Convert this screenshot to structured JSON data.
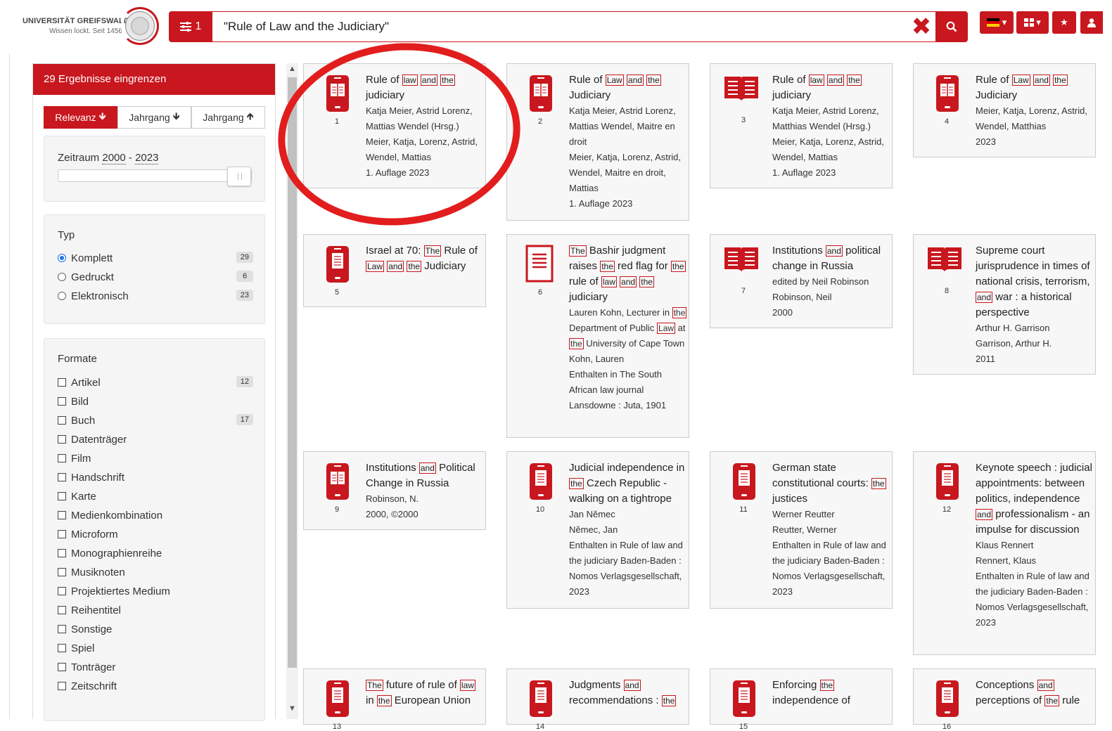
{
  "header": {
    "logo_line1": "UNIVERSITÄT GREIFSWALD",
    "logo_line2": "Wissen lockt. Seit 1456",
    "filter_count": "1",
    "search_value": "\"Rule of Law and the Judiciary\""
  },
  "sidebar": {
    "heading": "29 Ergebnisse eingrenzen",
    "sort": [
      "Relevanz",
      "Jahrgang",
      "Jahrgang"
    ],
    "time_label": "Zeitraum",
    "time_from": "2000",
    "time_sep": " - ",
    "time_to": "2023",
    "type_title": "Typ",
    "types": [
      {
        "label": "Komplett",
        "count": "29"
      },
      {
        "label": "Gedruckt",
        "count": "6"
      },
      {
        "label": "Elektronisch",
        "count": "23"
      }
    ],
    "format_title": "Formate",
    "formats": [
      {
        "label": "Artikel",
        "count": "12"
      },
      {
        "label": "Bild",
        "count": ""
      },
      {
        "label": "Buch",
        "count": "17"
      },
      {
        "label": "Datenträger",
        "count": ""
      },
      {
        "label": "Film",
        "count": ""
      },
      {
        "label": "Handschrift",
        "count": ""
      },
      {
        "label": "Karte",
        "count": ""
      },
      {
        "label": "Medienkombination",
        "count": ""
      },
      {
        "label": "Microform",
        "count": ""
      },
      {
        "label": "Monographienreihe",
        "count": ""
      },
      {
        "label": "Musiknoten",
        "count": ""
      },
      {
        "label": "Projektiertes Medium",
        "count": ""
      },
      {
        "label": "Reihentitel",
        "count": ""
      },
      {
        "label": "Sonstige",
        "count": ""
      },
      {
        "label": "Spiel",
        "count": ""
      },
      {
        "label": "Tonträger",
        "count": ""
      },
      {
        "label": "Zeitschrift",
        "count": ""
      }
    ]
  },
  "results": [
    {
      "num": "1",
      "title": "Rule of |law| |and| |the| judiciary",
      "meta": [
        "Katja Meier, Astrid Lorenz, Mattias Wendel (Hrsg.)",
        "Meier, Katja, Lorenz, Astrid, Wendel, Mattias",
        "1. Auflage 2023"
      ],
      "icon": "ebook-icon"
    },
    {
      "num": "2",
      "title": "Rule of |Law| |and| |the| Judiciary",
      "meta": [
        "Katja Meier, Astrid Lorenz, Mattias Wendel, Maitre en droit",
        "Meier, Katja, Lorenz, Astrid, Wendel, Maitre en droit, Mattias",
        "1. Auflage 2023"
      ],
      "icon": "ebook-icon"
    },
    {
      "num": "3",
      "title": "Rule of |law| |and| |the| judiciary",
      "meta": [
        "Katja Meier, Astrid Lorenz, Matthias Wendel (Hrsg.)",
        "Meier, Katja, Lorenz, Astrid, Wendel, Mattias",
        "1. Auflage 2023"
      ],
      "icon": "book-icon"
    },
    {
      "num": "4",
      "title": "Rule of |Law| |and| |the| Judiciary",
      "meta": [
        "Meier, Katja, Lorenz, Astrid, Wendel, Matthias",
        "2023"
      ],
      "icon": "ebook-icon"
    },
    {
      "num": "5",
      "title": "Israel at 70: |The| Rule of |Law| |and| |the| Judiciary",
      "meta": [],
      "icon": "earticle-icon"
    },
    {
      "num": "6",
      "title": "|The| Bashir judgment raises |the| red flag for |the| rule of |law| |and| |the| judiciary",
      "meta": [
        "Lauren Kohn, Lecturer in |the| Department of Public |Law| at |the| University of Cape Town",
        "Kohn, Lauren",
        "Enthalten in The South African law journal",
        "Lansdowne : Juta, 1901"
      ],
      "icon": "article-icon"
    },
    {
      "num": "7",
      "title": "Institutions |and| political change in Russia",
      "meta": [
        "edited by Neil Robinson",
        "Robinson, Neil",
        "2000"
      ],
      "icon": "book-icon"
    },
    {
      "num": "8",
      "title": "Supreme court jurisprudence in times of national crisis, terrorism, |and| war : a historical perspective",
      "meta": [
        "Arthur H. Garrison",
        "Garrison, Arthur H.",
        "2011"
      ],
      "icon": "book-icon"
    },
    {
      "num": "9",
      "title": "Institutions |and| Political Change in Russia",
      "meta": [
        "Robinson, N.",
        "2000, ©2000"
      ],
      "icon": "ebook-icon"
    },
    {
      "num": "10",
      "title": "Judicial independence in |the| Czech Republic - walking on a tightrope",
      "meta": [
        "Jan Němec",
        "Němec, Jan",
        "Enthalten in Rule of law and the judiciary Baden-Baden : Nomos Verlagsgesellschaft, 2023"
      ],
      "icon": "earticle-icon"
    },
    {
      "num": "11",
      "title": "German state constitutional courts: |the| justices",
      "meta": [
        "Werner Reutter",
        "Reutter, Werner",
        "Enthalten in Rule of law and the judiciary Baden-Baden : Nomos Verlagsgesellschaft, 2023"
      ],
      "icon": "earticle-icon"
    },
    {
      "num": "12",
      "title": "Keynote speech : judicial appointments: between politics, independence |and| professionalism - an impulse for discussion",
      "meta": [
        "Klaus Rennert",
        "Rennert, Klaus",
        "Enthalten in Rule of law and the judiciary Baden-Baden : Nomos Verlagsgesellschaft, 2023"
      ],
      "icon": "earticle-icon"
    },
    {
      "num": "13",
      "title": "|The| future of rule of |law| in |the| European Union",
      "meta": [],
      "icon": "earticle-icon"
    },
    {
      "num": "14",
      "title": "Judgments |and| recommendations : |the|",
      "meta": [],
      "icon": "earticle-icon"
    },
    {
      "num": "15",
      "title": "Enforcing |the| independence of",
      "meta": [],
      "icon": "earticle-icon"
    },
    {
      "num": "16",
      "title": "Conceptions |and| perceptions of |the| rule",
      "meta": [],
      "icon": "earticle-icon"
    }
  ],
  "colors": {
    "accent": "#c8171e",
    "highlight_circle": "#e21d1d"
  }
}
